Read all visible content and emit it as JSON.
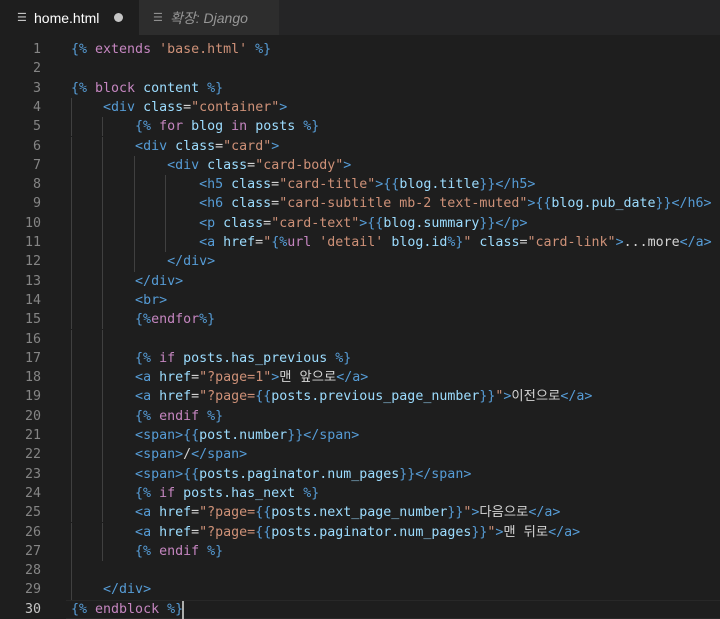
{
  "tabs": [
    {
      "label": "home.html",
      "icon": "file-lines-icon",
      "modified": true,
      "active": true
    },
    {
      "label": "확장: Django",
      "icon": "file-lines-icon",
      "modified": false,
      "active": false
    }
  ],
  "colors": {
    "tag": "#569cd6",
    "attr": "#9cdcfe",
    "string": "#ce9178",
    "keyword": "#c586c0",
    "text": "#d4d4d4",
    "delim": "#569cd6"
  },
  "editor": {
    "current_line": 30,
    "lines": [
      {
        "n": "1",
        "text": "{% extends 'base.html' %}"
      },
      {
        "n": "2",
        "text": ""
      },
      {
        "n": "3",
        "text": "{% block content %}"
      },
      {
        "n": "4",
        "text": "    <div class=\"container\">"
      },
      {
        "n": "5",
        "text": "        {% for blog in posts %}"
      },
      {
        "n": "6",
        "text": "        <div class=\"card\">"
      },
      {
        "n": "7",
        "text": "            <div class=\"card-body\">"
      },
      {
        "n": "8",
        "text": "                <h5 class=\"card-title\">{{blog.title}}</h5>"
      },
      {
        "n": "9",
        "text": "                <h6 class=\"card-subtitle mb-2 text-muted\">{{blog.pub_date}}</h6>"
      },
      {
        "n": "10",
        "text": "                <p class=\"card-text\">{{blog.summary}}</p>"
      },
      {
        "n": "11",
        "text": "                <a href=\"{%url 'detail' blog.id%}\" class=\"card-link\">...more</a>"
      },
      {
        "n": "12",
        "text": "            </div>"
      },
      {
        "n": "13",
        "text": "        </div>"
      },
      {
        "n": "14",
        "text": "        <br>"
      },
      {
        "n": "15",
        "text": "        {%endfor%}"
      },
      {
        "n": "16",
        "text": ""
      },
      {
        "n": "17",
        "text": "        {% if posts.has_previous %}"
      },
      {
        "n": "18",
        "text": "        <a href=\"?page=1\">맨 앞으로</a>"
      },
      {
        "n": "19",
        "text": "        <a href=\"?page={{posts.previous_page_number}}\">이전으로</a>"
      },
      {
        "n": "20",
        "text": "        {% endif %}"
      },
      {
        "n": "21",
        "text": "        <span>{{post.number}}</span>"
      },
      {
        "n": "22",
        "text": "        <span>/</span>"
      },
      {
        "n": "23",
        "text": "        <span>{{posts.paginator.num_pages}}</span>"
      },
      {
        "n": "24",
        "text": "        {% if posts.has_next %}"
      },
      {
        "n": "25",
        "text": "        <a href=\"?page={{posts.next_page_number}}\">다음으로</a>"
      },
      {
        "n": "26",
        "text": "        <a href=\"?page={{posts.paginator.num_pages}}\">맨 뒤로</a>"
      },
      {
        "n": "27",
        "text": "        {% endif %}"
      },
      {
        "n": "28",
        "text": ""
      },
      {
        "n": "29",
        "text": "    </div>"
      },
      {
        "n": "30",
        "text": "{% endblock %}"
      }
    ]
  }
}
